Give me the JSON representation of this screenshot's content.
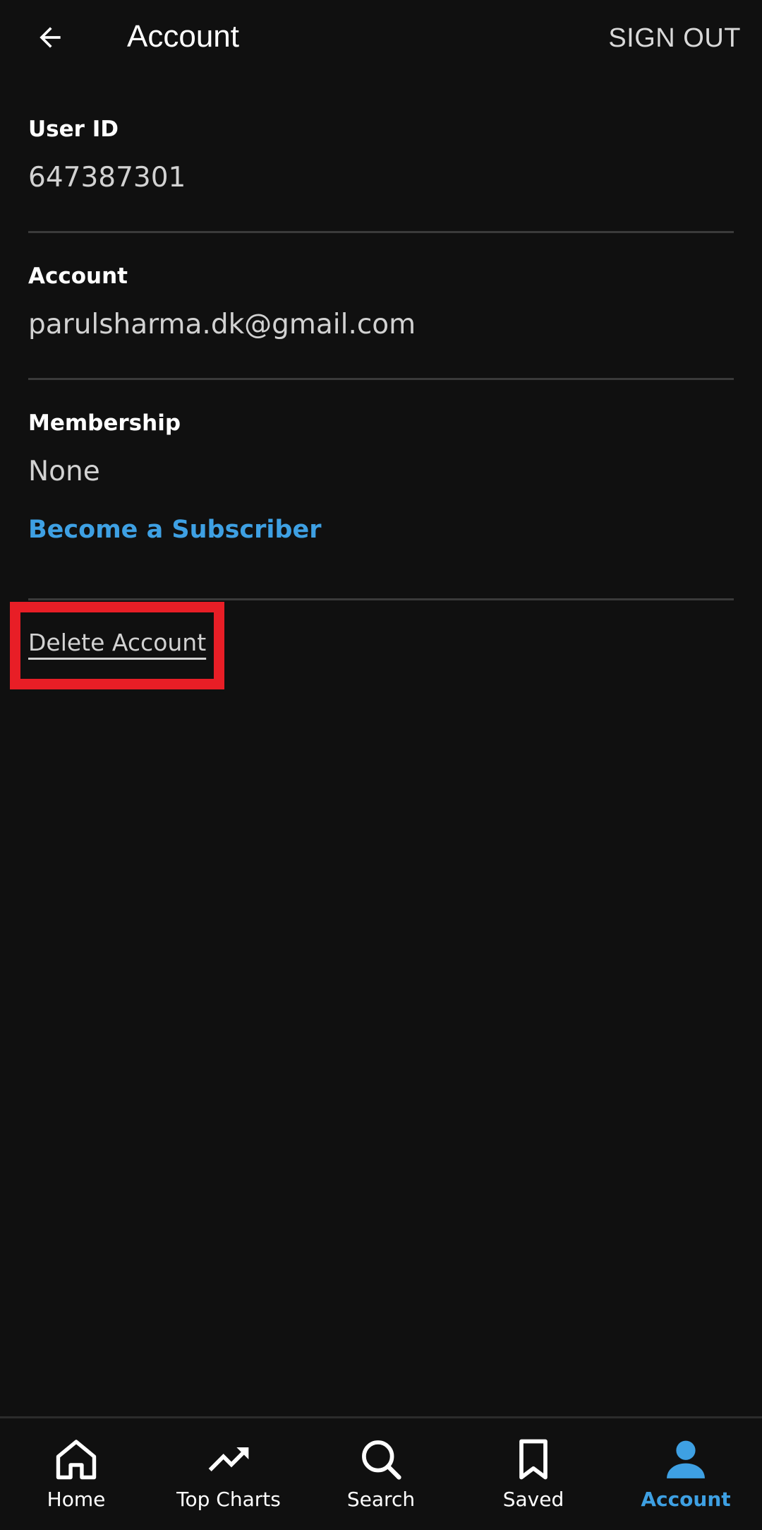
{
  "header": {
    "title": "Account",
    "sign_out_label": "SIGN OUT",
    "back_icon": "arrow-left-icon"
  },
  "sections": {
    "user_id": {
      "label": "User ID",
      "value": "647387301"
    },
    "account": {
      "label": "Account",
      "value": "parulsharma.dk@gmail.com"
    },
    "membership": {
      "label": "Membership",
      "value": "None",
      "cta": "Become a Subscriber"
    }
  },
  "delete_account_label": "Delete Account",
  "bottom_nav": {
    "items": [
      {
        "label": "Home",
        "icon": "home-icon"
      },
      {
        "label": "Top Charts",
        "icon": "trending-up-icon"
      },
      {
        "label": "Search",
        "icon": "search-icon"
      },
      {
        "label": "Saved",
        "icon": "bookmark-icon"
      },
      {
        "label": "Account",
        "icon": "person-icon",
        "active": true
      }
    ]
  },
  "colors": {
    "background": "#101010",
    "accent": "#3ea0e3",
    "highlight": "#e81e26",
    "divider": "#3a3a3a"
  }
}
